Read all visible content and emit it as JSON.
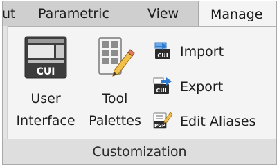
{
  "tabs": [
    {
      "label": "ut",
      "active": false
    },
    {
      "label": "Parametric",
      "active": false
    },
    {
      "label": "View",
      "active": false
    },
    {
      "label": "Manage",
      "active": true
    }
  ],
  "panel": {
    "title": "Customization",
    "large_buttons": [
      {
        "line1": "User",
        "line2": "Interface",
        "icon": "cui-icon",
        "icon_text": "CUI"
      },
      {
        "line1": "Tool",
        "line2": "Palettes",
        "icon": "tool-palettes-icon"
      }
    ],
    "small_buttons": [
      {
        "label": "Import",
        "icon": "import-icon",
        "icon_text": "CUI"
      },
      {
        "label": "Export",
        "icon": "export-icon",
        "icon_text": "CUI"
      },
      {
        "label": "Edit Aliases",
        "icon": "edit-aliases-icon",
        "icon_text": "PGP"
      }
    ]
  },
  "colors": {
    "tab_strip": "#cfcfcf",
    "panel_bg": "#f4f4f4",
    "title_bar": "#dedede",
    "icon_blue": "#2f7bd0"
  }
}
